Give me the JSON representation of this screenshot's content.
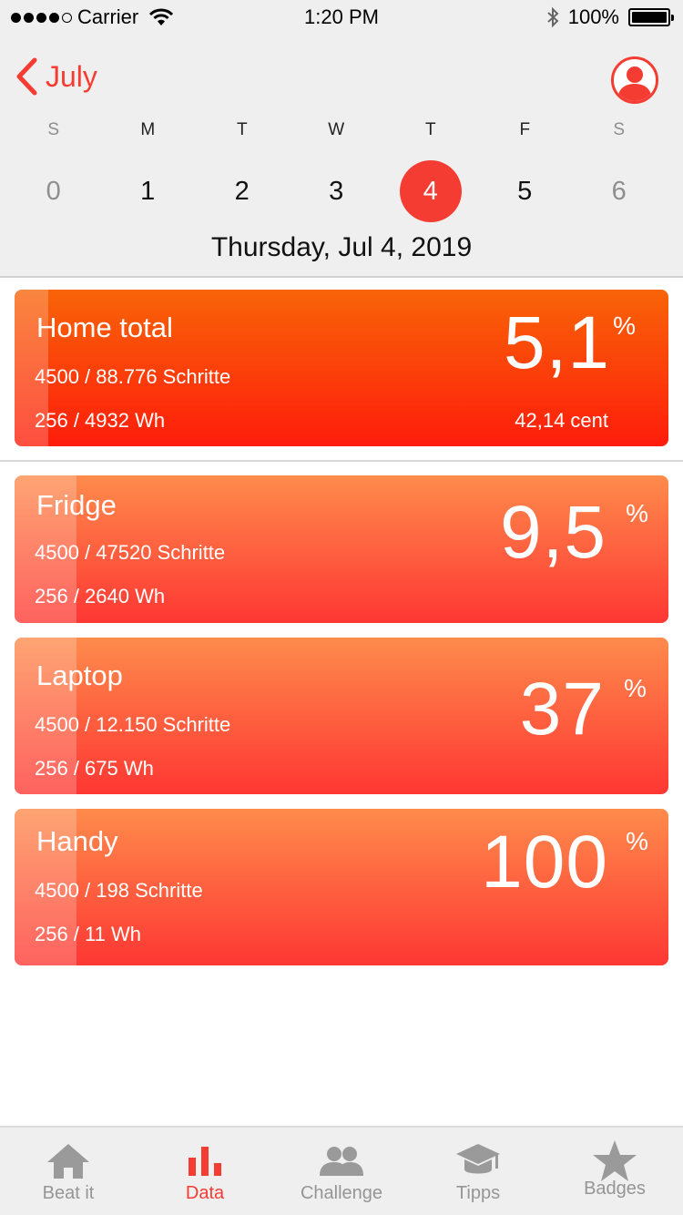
{
  "status_bar": {
    "carrier": "Carrier",
    "time": "1:20 PM",
    "battery": "100%"
  },
  "nav": {
    "back_label": "July",
    "profile_icon": "person-icon"
  },
  "calendar": {
    "weekdays": [
      "S",
      "M",
      "T",
      "W",
      "T",
      "F",
      "S"
    ],
    "days": [
      "0",
      "1",
      "2",
      "3",
      "4",
      "5",
      "6"
    ],
    "selected_index": 4,
    "date_title": "Thursday, Jul 4, 2019"
  },
  "total": {
    "name": "Home total",
    "steps": "4500 / 88.776 Schritte",
    "energy": "256 / 4932 Wh",
    "percent": "5,1",
    "percent_sign": "%",
    "cost": "42,14 cent"
  },
  "devices": [
    {
      "name": "Fridge",
      "steps": "4500 / 47520 Schritte",
      "energy": "256 / 2640 Wh",
      "percent": "9,5",
      "percent_sign": "%"
    },
    {
      "name": "Laptop",
      "steps": "4500 / 12.150 Schritte",
      "energy": "256 / 675 Wh",
      "percent": "37",
      "percent_sign": "%"
    },
    {
      "name": "Handy",
      "steps": "4500 / 198 Schritte",
      "energy": "256 / 11 Wh",
      "percent": "100",
      "percent_sign": "%"
    }
  ],
  "tabs": [
    {
      "label": "Beat it",
      "icon": "home-icon"
    },
    {
      "label": "Data",
      "icon": "bar-chart-icon"
    },
    {
      "label": "Challenge",
      "icon": "people-icon"
    },
    {
      "label": "Tipps",
      "icon": "graduation-cap-icon"
    },
    {
      "label": "Badges",
      "icon": "star-icon"
    }
  ],
  "active_tab": "Data",
  "colors": {
    "accent": "#f53c33",
    "total_gradient": [
      "#f86408",
      "#fe1d0b"
    ],
    "device_gradient": [
      "#fe8b4c",
      "#fe3733"
    ]
  }
}
